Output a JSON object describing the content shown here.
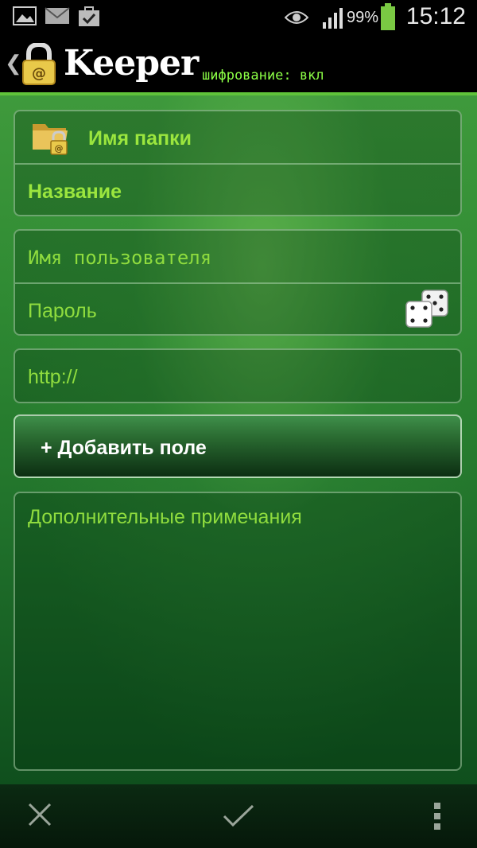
{
  "status_bar": {
    "battery_percent": "99%",
    "time": "15:12"
  },
  "app_bar": {
    "logo_text": "Keeper",
    "registered_mark": "®",
    "encryption_status": "шифрование: вкл"
  },
  "form": {
    "folder_label": "Имя папки",
    "title_placeholder": "Название",
    "username_placeholder": "Имя пользователя",
    "password_placeholder": "Пароль",
    "url_value": "http://",
    "add_field_label": "+ Добавить поле",
    "notes_placeholder": "Дополнительные примечания"
  },
  "colors": {
    "accent": "#8cff46",
    "field_text": "#8fdc3e",
    "divider": "#5fc33a"
  },
  "bottom_bar": {
    "cancel_icon": "close-icon",
    "save_icon": "check-icon",
    "menu_icon": "overflow-menu-icon"
  }
}
